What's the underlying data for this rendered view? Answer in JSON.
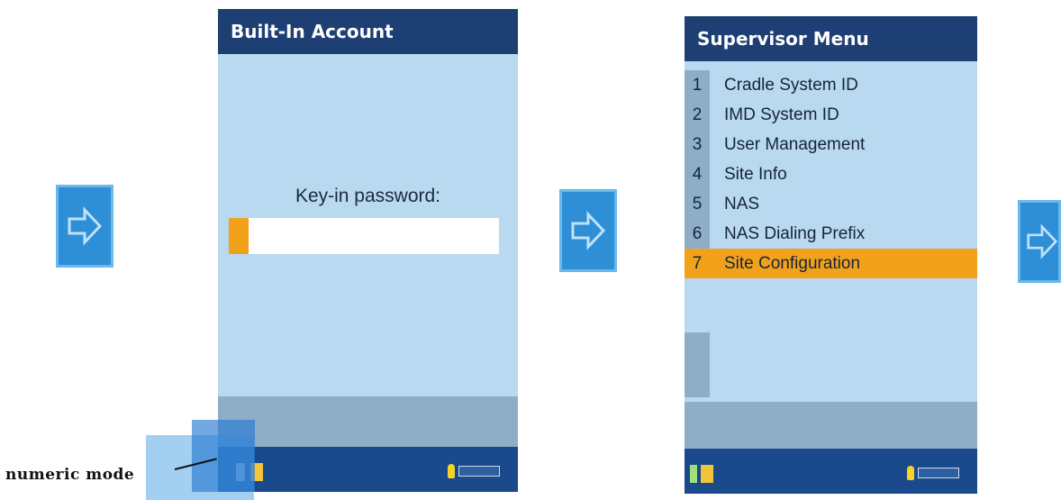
{
  "screen1": {
    "title": "Built-In Account",
    "prompt": "Key-in password:",
    "password_value": ""
  },
  "screen2": {
    "title": "Supervisor Menu",
    "items": [
      {
        "num": "1",
        "label": "Cradle System ID"
      },
      {
        "num": "2",
        "label": "IMD System ID"
      },
      {
        "num": "3",
        "label": "User Management"
      },
      {
        "num": "4",
        "label": "Site Info"
      },
      {
        "num": "5",
        "label": "NAS"
      },
      {
        "num": "6",
        "label": "NAS Dialing Prefix"
      },
      {
        "num": "7",
        "label": "Site Configuration"
      }
    ],
    "selected_index": 6
  },
  "annotation": {
    "numeric_mode_label": "numeric mode"
  },
  "icons": {
    "arrow": "right-arrow-icon",
    "tray_indicator": "battery-icon"
  },
  "colors": {
    "title_bar": "#1e3f73",
    "screen_bg": "#b8d9ef",
    "highlight": "#f2a21a",
    "arrow_box": "#2f8fd6"
  }
}
